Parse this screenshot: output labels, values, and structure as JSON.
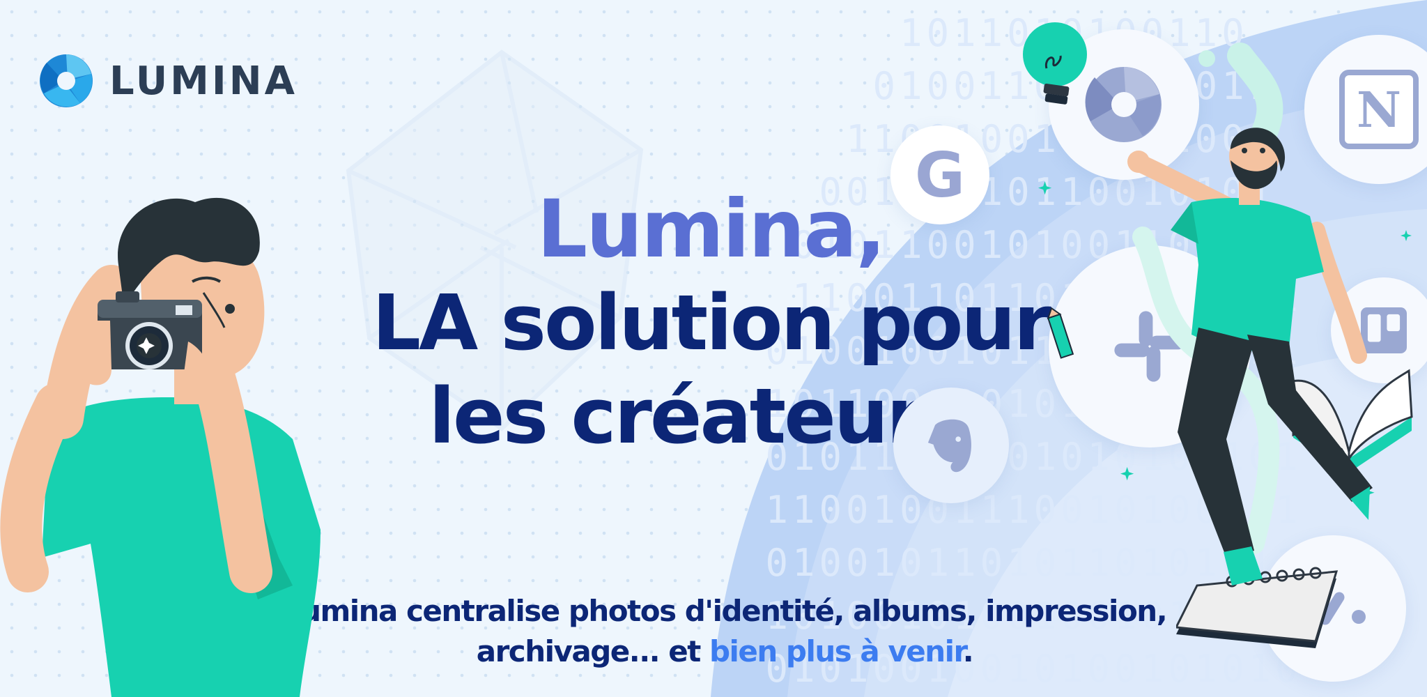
{
  "brand": {
    "name": "LUMINA",
    "logo_icon": "lumina-aperture-logo"
  },
  "hero": {
    "line1": "Lumina,",
    "line2": "LA solution pour",
    "line3": "les créateurs."
  },
  "subtitle": {
    "part1": "Lumina centralise photos d'identité, albums, impression,",
    "part2": "archivage... et ",
    "highlight": "bien plus à venir",
    "end": "."
  },
  "integrations": {
    "google_letter": "G",
    "notion_letter": "N",
    "icons": [
      "google-icon",
      "lumina-icon",
      "notion-icon",
      "slack-icon",
      "trello-icon",
      "evernote-icon",
      "monday-icon"
    ]
  },
  "colors": {
    "accent": "#5a6fd3",
    "navy": "#0c2676",
    "highlight": "#3c7cf0",
    "teal": "#17d1b0",
    "background": "#eef6fd"
  }
}
